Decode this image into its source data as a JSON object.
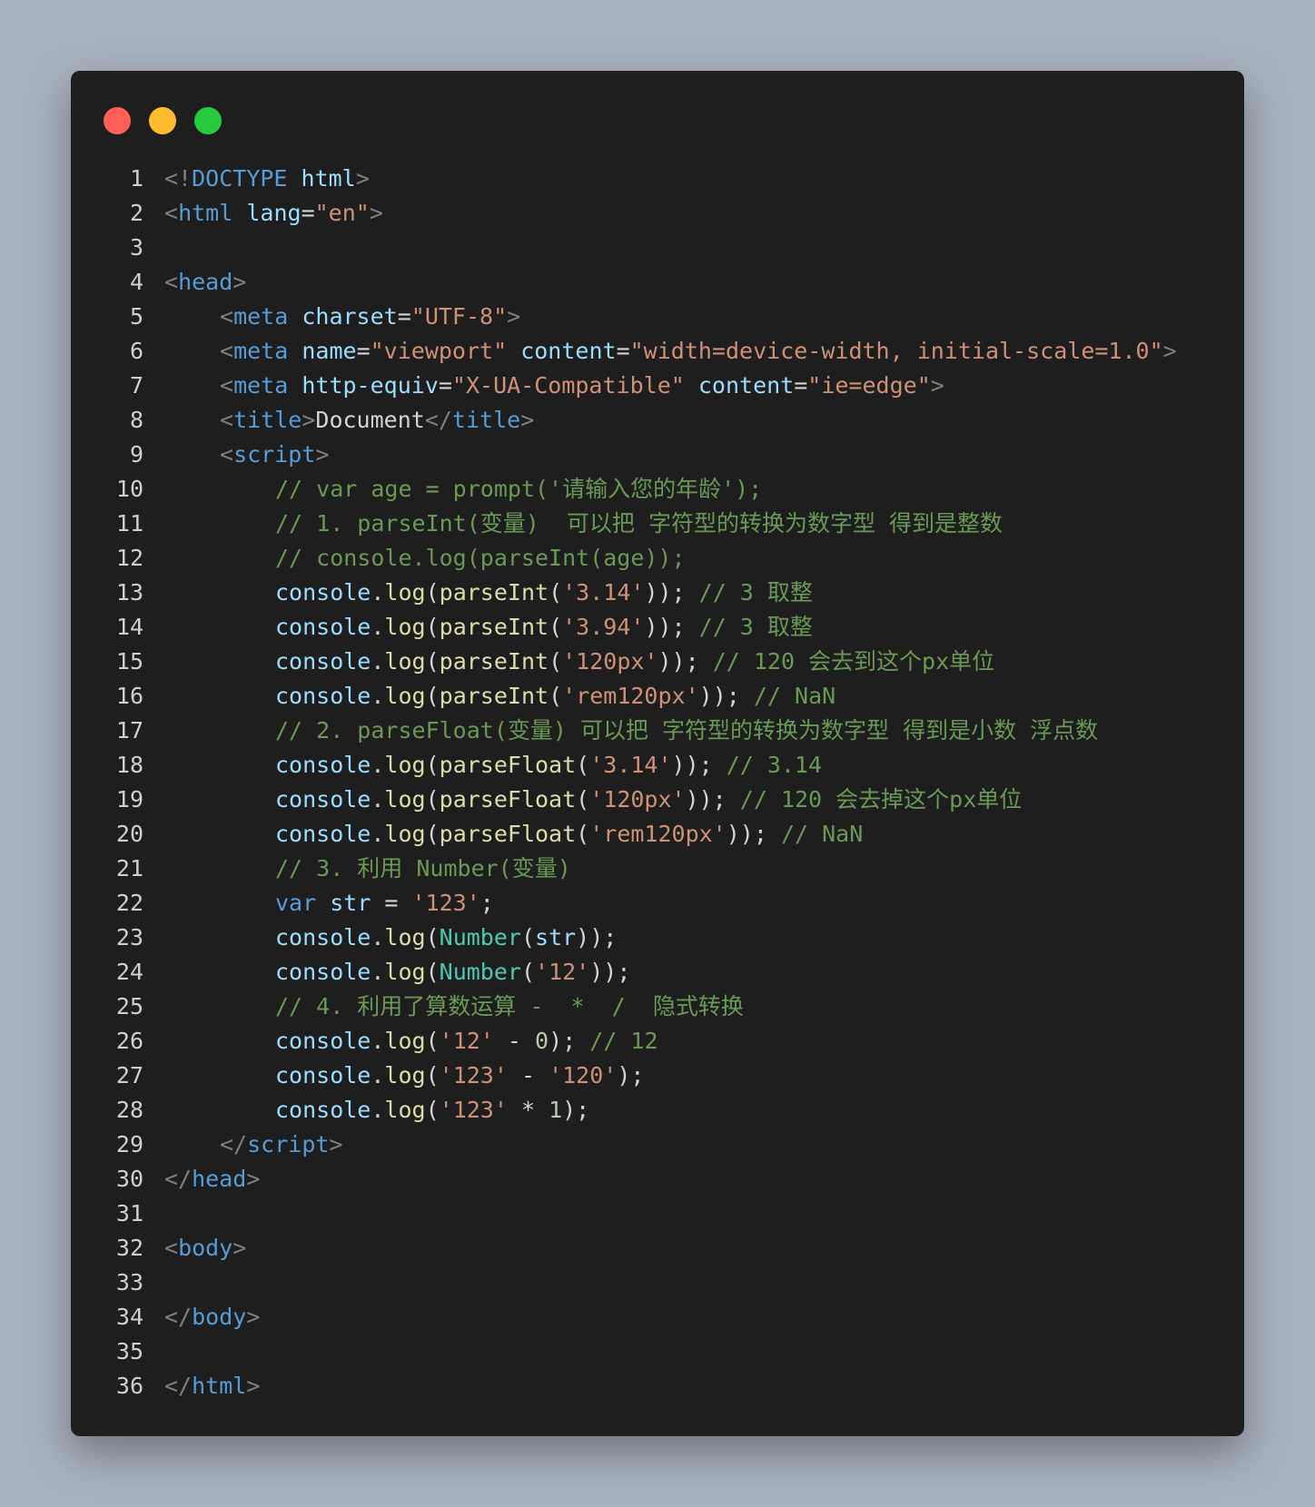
{
  "window": {
    "controls": [
      "close",
      "minimize",
      "maximize"
    ],
    "colors": {
      "background": "#1e1e1e",
      "close": "#ff5f56",
      "minimize": "#ffbd2e",
      "maximize": "#27c93f"
    }
  },
  "code": {
    "lines": [
      {
        "n": "1",
        "tokens": [
          {
            "t": "<!",
            "c": "punc"
          },
          {
            "t": "DOCTYPE",
            "c": "tag"
          },
          {
            "t": " ",
            "c": "plain"
          },
          {
            "t": "html",
            "c": "attr"
          },
          {
            "t": ">",
            "c": "punc"
          }
        ]
      },
      {
        "n": "2",
        "tokens": [
          {
            "t": "<",
            "c": "punc"
          },
          {
            "t": "html",
            "c": "tag"
          },
          {
            "t": " ",
            "c": "plain"
          },
          {
            "t": "lang",
            "c": "attr"
          },
          {
            "t": "=",
            "c": "plain"
          },
          {
            "t": "\"en\"",
            "c": "str"
          },
          {
            "t": ">",
            "c": "punc"
          }
        ]
      },
      {
        "n": "3",
        "tokens": []
      },
      {
        "n": "4",
        "tokens": [
          {
            "t": "<",
            "c": "punc"
          },
          {
            "t": "head",
            "c": "tag"
          },
          {
            "t": ">",
            "c": "punc"
          }
        ]
      },
      {
        "n": "5",
        "indent": 1,
        "tokens": [
          {
            "t": "<",
            "c": "punc"
          },
          {
            "t": "meta",
            "c": "tag"
          },
          {
            "t": " ",
            "c": "plain"
          },
          {
            "t": "charset",
            "c": "attr"
          },
          {
            "t": "=",
            "c": "plain"
          },
          {
            "t": "\"UTF-8\"",
            "c": "str"
          },
          {
            "t": ">",
            "c": "punc"
          }
        ]
      },
      {
        "n": "6",
        "indent": 1,
        "tokens": [
          {
            "t": "<",
            "c": "punc"
          },
          {
            "t": "meta",
            "c": "tag"
          },
          {
            "t": " ",
            "c": "plain"
          },
          {
            "t": "name",
            "c": "attr"
          },
          {
            "t": "=",
            "c": "plain"
          },
          {
            "t": "\"viewport\"",
            "c": "str"
          },
          {
            "t": " ",
            "c": "plain"
          },
          {
            "t": "content",
            "c": "attr"
          },
          {
            "t": "=",
            "c": "plain"
          },
          {
            "t": "\"width=device-width, initial-scale=1.0\"",
            "c": "str"
          },
          {
            "t": ">",
            "c": "punc"
          }
        ]
      },
      {
        "n": "7",
        "indent": 1,
        "tokens": [
          {
            "t": "<",
            "c": "punc"
          },
          {
            "t": "meta",
            "c": "tag"
          },
          {
            "t": " ",
            "c": "plain"
          },
          {
            "t": "http-equiv",
            "c": "attr"
          },
          {
            "t": "=",
            "c": "plain"
          },
          {
            "t": "\"X-UA-Compatible\"",
            "c": "str"
          },
          {
            "t": " ",
            "c": "plain"
          },
          {
            "t": "content",
            "c": "attr"
          },
          {
            "t": "=",
            "c": "plain"
          },
          {
            "t": "\"ie=edge\"",
            "c": "str"
          },
          {
            "t": ">",
            "c": "punc"
          }
        ]
      },
      {
        "n": "8",
        "indent": 1,
        "tokens": [
          {
            "t": "<",
            "c": "punc"
          },
          {
            "t": "title",
            "c": "tag"
          },
          {
            "t": ">",
            "c": "punc"
          },
          {
            "t": "Document",
            "c": "plain"
          },
          {
            "t": "</",
            "c": "punc"
          },
          {
            "t": "title",
            "c": "tag"
          },
          {
            "t": ">",
            "c": "punc"
          }
        ]
      },
      {
        "n": "9",
        "indent": 1,
        "tokens": [
          {
            "t": "<",
            "c": "punc"
          },
          {
            "t": "script",
            "c": "tag"
          },
          {
            "t": ">",
            "c": "punc"
          }
        ]
      },
      {
        "n": "10",
        "indent": 2,
        "tokens": [
          {
            "t": "// var age = prompt('请输入您的年龄');",
            "c": "cmt"
          }
        ]
      },
      {
        "n": "11",
        "indent": 2,
        "tokens": [
          {
            "t": "// 1. parseInt(变量)  可以把 字符型的转换为数字型 得到是整数",
            "c": "cmt"
          }
        ]
      },
      {
        "n": "12",
        "indent": 2,
        "tokens": [
          {
            "t": "// console.log(parseInt(age));",
            "c": "cmt"
          }
        ]
      },
      {
        "n": "13",
        "indent": 2,
        "tokens": [
          {
            "t": "console",
            "c": "obj"
          },
          {
            "t": ".",
            "c": "plain"
          },
          {
            "t": "log",
            "c": "fn"
          },
          {
            "t": "(",
            "c": "plain"
          },
          {
            "t": "parseInt",
            "c": "fn"
          },
          {
            "t": "(",
            "c": "plain"
          },
          {
            "t": "'3.14'",
            "c": "str"
          },
          {
            "t": ")); ",
            "c": "plain"
          },
          {
            "t": "// 3 取整",
            "c": "cmt"
          }
        ]
      },
      {
        "n": "14",
        "indent": 2,
        "tokens": [
          {
            "t": "console",
            "c": "obj"
          },
          {
            "t": ".",
            "c": "plain"
          },
          {
            "t": "log",
            "c": "fn"
          },
          {
            "t": "(",
            "c": "plain"
          },
          {
            "t": "parseInt",
            "c": "fn"
          },
          {
            "t": "(",
            "c": "plain"
          },
          {
            "t": "'3.94'",
            "c": "str"
          },
          {
            "t": ")); ",
            "c": "plain"
          },
          {
            "t": "// 3 取整",
            "c": "cmt"
          }
        ]
      },
      {
        "n": "15",
        "indent": 2,
        "tokens": [
          {
            "t": "console",
            "c": "obj"
          },
          {
            "t": ".",
            "c": "plain"
          },
          {
            "t": "log",
            "c": "fn"
          },
          {
            "t": "(",
            "c": "plain"
          },
          {
            "t": "parseInt",
            "c": "fn"
          },
          {
            "t": "(",
            "c": "plain"
          },
          {
            "t": "'120px'",
            "c": "str"
          },
          {
            "t": ")); ",
            "c": "plain"
          },
          {
            "t": "// 120 会去到这个px单位",
            "c": "cmt"
          }
        ]
      },
      {
        "n": "16",
        "indent": 2,
        "tokens": [
          {
            "t": "console",
            "c": "obj"
          },
          {
            "t": ".",
            "c": "plain"
          },
          {
            "t": "log",
            "c": "fn"
          },
          {
            "t": "(",
            "c": "plain"
          },
          {
            "t": "parseInt",
            "c": "fn"
          },
          {
            "t": "(",
            "c": "plain"
          },
          {
            "t": "'rem120px'",
            "c": "str"
          },
          {
            "t": ")); ",
            "c": "plain"
          },
          {
            "t": "// NaN",
            "c": "cmt"
          }
        ]
      },
      {
        "n": "17",
        "indent": 2,
        "tokens": [
          {
            "t": "// 2. parseFloat(变量) 可以把 字符型的转换为数字型 得到是小数 浮点数",
            "c": "cmt"
          }
        ]
      },
      {
        "n": "18",
        "indent": 2,
        "tokens": [
          {
            "t": "console",
            "c": "obj"
          },
          {
            "t": ".",
            "c": "plain"
          },
          {
            "t": "log",
            "c": "fn"
          },
          {
            "t": "(",
            "c": "plain"
          },
          {
            "t": "parseFloat",
            "c": "fn"
          },
          {
            "t": "(",
            "c": "plain"
          },
          {
            "t": "'3.14'",
            "c": "str"
          },
          {
            "t": ")); ",
            "c": "plain"
          },
          {
            "t": "// 3.14",
            "c": "cmt"
          }
        ]
      },
      {
        "n": "19",
        "indent": 2,
        "tokens": [
          {
            "t": "console",
            "c": "obj"
          },
          {
            "t": ".",
            "c": "plain"
          },
          {
            "t": "log",
            "c": "fn"
          },
          {
            "t": "(",
            "c": "plain"
          },
          {
            "t": "parseFloat",
            "c": "fn"
          },
          {
            "t": "(",
            "c": "plain"
          },
          {
            "t": "'120px'",
            "c": "str"
          },
          {
            "t": ")); ",
            "c": "plain"
          },
          {
            "t": "// 120 会去掉这个px单位",
            "c": "cmt"
          }
        ]
      },
      {
        "n": "20",
        "indent": 2,
        "tokens": [
          {
            "t": "console",
            "c": "obj"
          },
          {
            "t": ".",
            "c": "plain"
          },
          {
            "t": "log",
            "c": "fn"
          },
          {
            "t": "(",
            "c": "plain"
          },
          {
            "t": "parseFloat",
            "c": "fn"
          },
          {
            "t": "(",
            "c": "plain"
          },
          {
            "t": "'rem120px'",
            "c": "str"
          },
          {
            "t": ")); ",
            "c": "plain"
          },
          {
            "t": "// NaN",
            "c": "cmt"
          }
        ]
      },
      {
        "n": "21",
        "indent": 2,
        "tokens": [
          {
            "t": "// 3. 利用 Number(变量)",
            "c": "cmt"
          }
        ]
      },
      {
        "n": "22",
        "indent": 2,
        "tokens": [
          {
            "t": "var",
            "c": "kw"
          },
          {
            "t": " ",
            "c": "plain"
          },
          {
            "t": "str",
            "c": "obj"
          },
          {
            "t": " = ",
            "c": "plain"
          },
          {
            "t": "'123'",
            "c": "str"
          },
          {
            "t": ";",
            "c": "plain"
          }
        ]
      },
      {
        "n": "23",
        "indent": 2,
        "tokens": [
          {
            "t": "console",
            "c": "obj"
          },
          {
            "t": ".",
            "c": "plain"
          },
          {
            "t": "log",
            "c": "fn"
          },
          {
            "t": "(",
            "c": "plain"
          },
          {
            "t": "Number",
            "c": "cls"
          },
          {
            "t": "(",
            "c": "plain"
          },
          {
            "t": "str",
            "c": "obj"
          },
          {
            "t": "));",
            "c": "plain"
          }
        ]
      },
      {
        "n": "24",
        "indent": 2,
        "tokens": [
          {
            "t": "console",
            "c": "obj"
          },
          {
            "t": ".",
            "c": "plain"
          },
          {
            "t": "log",
            "c": "fn"
          },
          {
            "t": "(",
            "c": "plain"
          },
          {
            "t": "Number",
            "c": "cls"
          },
          {
            "t": "(",
            "c": "plain"
          },
          {
            "t": "'12'",
            "c": "str"
          },
          {
            "t": "));",
            "c": "plain"
          }
        ]
      },
      {
        "n": "25",
        "indent": 2,
        "tokens": [
          {
            "t": "// 4. 利用了算数运算 -  *  /  隐式转换",
            "c": "cmt"
          }
        ]
      },
      {
        "n": "26",
        "indent": 2,
        "tokens": [
          {
            "t": "console",
            "c": "obj"
          },
          {
            "t": ".",
            "c": "plain"
          },
          {
            "t": "log",
            "c": "fn"
          },
          {
            "t": "(",
            "c": "plain"
          },
          {
            "t": "'12'",
            "c": "str"
          },
          {
            "t": " - ",
            "c": "plain"
          },
          {
            "t": "0",
            "c": "num"
          },
          {
            "t": "); ",
            "c": "plain"
          },
          {
            "t": "// 12",
            "c": "cmt"
          }
        ]
      },
      {
        "n": "27",
        "indent": 2,
        "tokens": [
          {
            "t": "console",
            "c": "obj"
          },
          {
            "t": ".",
            "c": "plain"
          },
          {
            "t": "log",
            "c": "fn"
          },
          {
            "t": "(",
            "c": "plain"
          },
          {
            "t": "'123'",
            "c": "str"
          },
          {
            "t": " - ",
            "c": "plain"
          },
          {
            "t": "'120'",
            "c": "str"
          },
          {
            "t": ");",
            "c": "plain"
          }
        ]
      },
      {
        "n": "28",
        "indent": 2,
        "tokens": [
          {
            "t": "console",
            "c": "obj"
          },
          {
            "t": ".",
            "c": "plain"
          },
          {
            "t": "log",
            "c": "fn"
          },
          {
            "t": "(",
            "c": "plain"
          },
          {
            "t": "'123'",
            "c": "str"
          },
          {
            "t": " * ",
            "c": "plain"
          },
          {
            "t": "1",
            "c": "num"
          },
          {
            "t": ");",
            "c": "plain"
          }
        ]
      },
      {
        "n": "29",
        "indent": 1,
        "tokens": [
          {
            "t": "</",
            "c": "punc"
          },
          {
            "t": "script",
            "c": "tag"
          },
          {
            "t": ">",
            "c": "punc"
          }
        ]
      },
      {
        "n": "30",
        "tokens": [
          {
            "t": "</",
            "c": "punc"
          },
          {
            "t": "head",
            "c": "tag"
          },
          {
            "t": ">",
            "c": "punc"
          }
        ]
      },
      {
        "n": "31",
        "tokens": []
      },
      {
        "n": "32",
        "tokens": [
          {
            "t": "<",
            "c": "punc"
          },
          {
            "t": "body",
            "c": "tag"
          },
          {
            "t": ">",
            "c": "punc"
          }
        ]
      },
      {
        "n": "33",
        "tokens": []
      },
      {
        "n": "34",
        "tokens": [
          {
            "t": "</",
            "c": "punc"
          },
          {
            "t": "body",
            "c": "tag"
          },
          {
            "t": ">",
            "c": "punc"
          }
        ]
      },
      {
        "n": "35",
        "tokens": []
      },
      {
        "n": "36",
        "tokens": [
          {
            "t": "</",
            "c": "punc"
          },
          {
            "t": "html",
            "c": "tag"
          },
          {
            "t": ">",
            "c": "punc"
          }
        ]
      }
    ]
  }
}
